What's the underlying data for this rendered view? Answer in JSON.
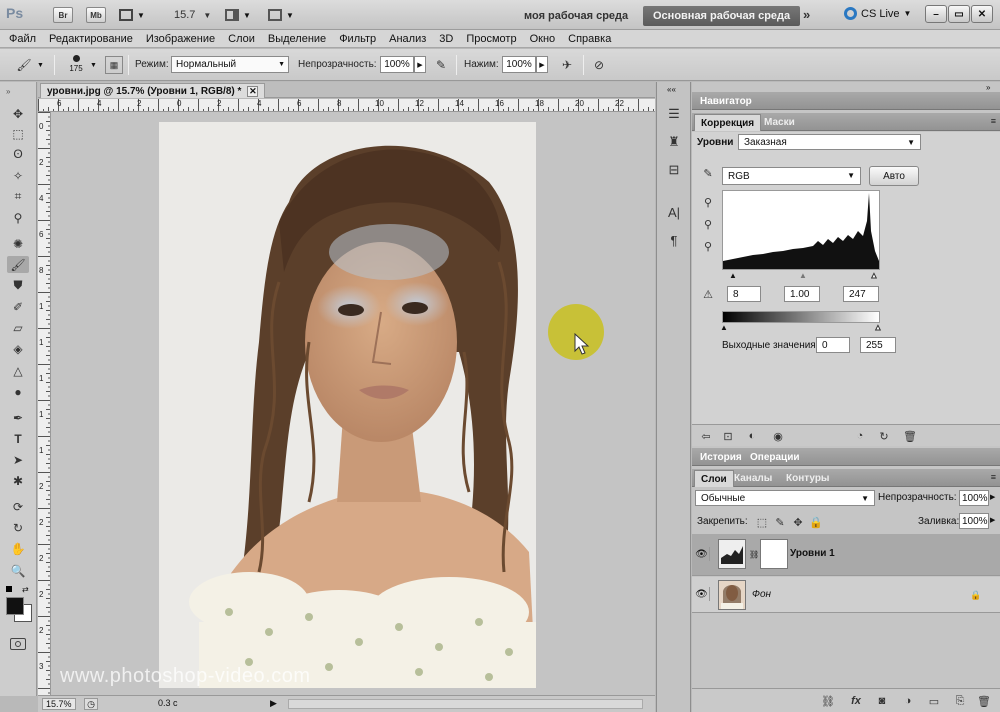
{
  "appbar": {
    "logo": "Ps",
    "br": "Br",
    "mb": "Mb",
    "zoom": "15.7",
    "workspace_user": "моя рабочая среда",
    "workspace_main": "Основная рабочая среда",
    "cslive": "CS Live"
  },
  "menu": [
    "Файл",
    "Редактирование",
    "Изображение",
    "Слои",
    "Выделение",
    "Фильтр",
    "Анализ",
    "3D",
    "Просмотр",
    "Окно",
    "Справка"
  ],
  "options": {
    "brush_size": "175",
    "mode_label": "Режим:",
    "mode_value": "Нормальный",
    "opacity_label": "Непрозрачность:",
    "opacity_value": "100%",
    "flow_label": "Нажим:",
    "flow_value": "100%"
  },
  "document": {
    "tab_title": "уровни.jpg @ 15.7% (Уровни 1, RGB/8) *",
    "ruler_top": [
      "6",
      "4",
      "2",
      "0",
      "2",
      "4",
      "6",
      "8",
      "10",
      "12",
      "14",
      "16",
      "18",
      "20",
      "22"
    ],
    "ruler_left": [
      "0",
      "2",
      "4",
      "6",
      "8",
      "1",
      "1",
      "1",
      "1",
      "1",
      "2",
      "2",
      "2",
      "2",
      "2",
      "3"
    ],
    "watermark": "www.photoshop-video.com",
    "status_zoom": "15.7%",
    "status_info": "0.3 с"
  },
  "panels": {
    "navigator_tab": "Навигатор",
    "adjustments_tab": "Коррекция",
    "masks_tab": "Маски",
    "levels_label": "Уровни",
    "preset_value": "Заказная",
    "channel_value": "RGB",
    "auto_button": "Авто",
    "input_black": "8",
    "input_gamma": "1.00",
    "input_white": "247",
    "output_label": "Выходные значения:",
    "output_black": "0",
    "output_white": "255",
    "history_tab": "История",
    "actions_tab": "Операции",
    "layers_tab": "Слои",
    "channels_tab": "Каналы",
    "paths_tab": "Контуры",
    "blend_mode": "Обычные",
    "layer_opacity_label": "Непрозрачность:",
    "layer_opacity_value": "100%",
    "lock_label": "Закрепить:",
    "fill_label": "Заливка:",
    "fill_value": "100%",
    "layer1_name": "Уровни 1",
    "layer2_name": "Фон"
  }
}
